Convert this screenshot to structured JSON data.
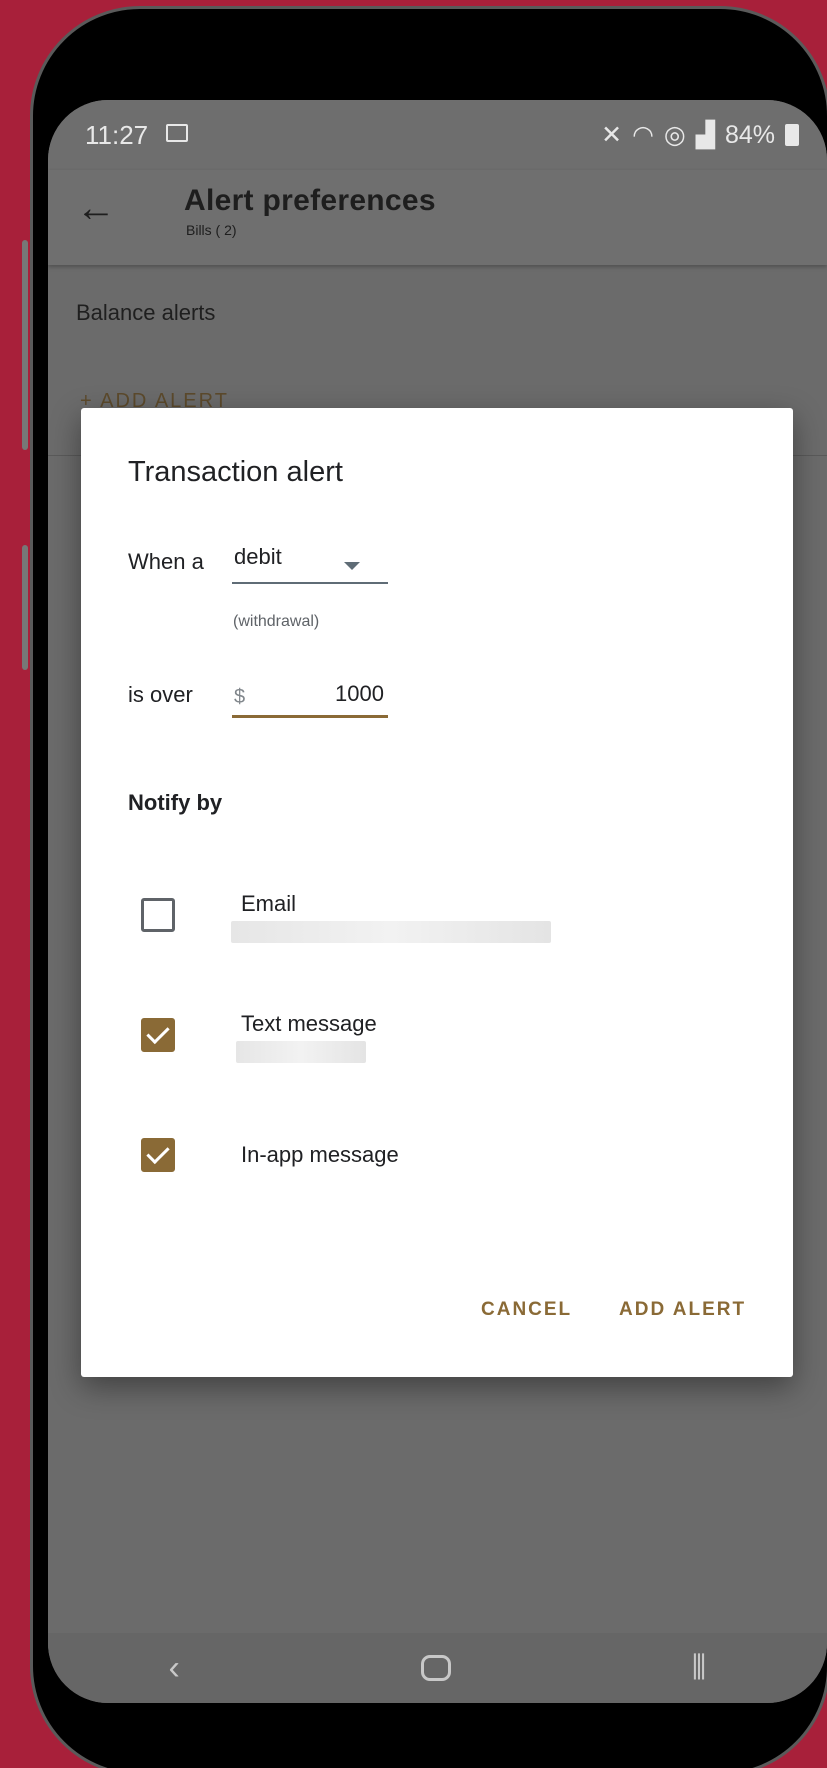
{
  "status_bar": {
    "time": "11:27",
    "battery": "84%"
  },
  "app_bar": {
    "title": "Alert preferences",
    "subtitle": "Bills (    2)"
  },
  "background": {
    "section_title": "Balance alerts",
    "add_alert": "+ ADD ALERT"
  },
  "dialog": {
    "title": "Transaction alert",
    "when_label": "When a",
    "type_select": {
      "value": "debit",
      "helper": "(withdrawal)"
    },
    "over_label": "is over",
    "amount": {
      "prefix": "$",
      "value": "1000"
    },
    "notify_title": "Notify by",
    "options": [
      {
        "label": "Email",
        "checked": false
      },
      {
        "label": "Text message",
        "checked": true
      },
      {
        "label": "In-app message",
        "checked": true
      }
    ],
    "cancel_label": "CANCEL",
    "add_label": "ADD ALERT"
  },
  "colors": {
    "accent": "#8a6a36",
    "background": "#a8203a"
  }
}
